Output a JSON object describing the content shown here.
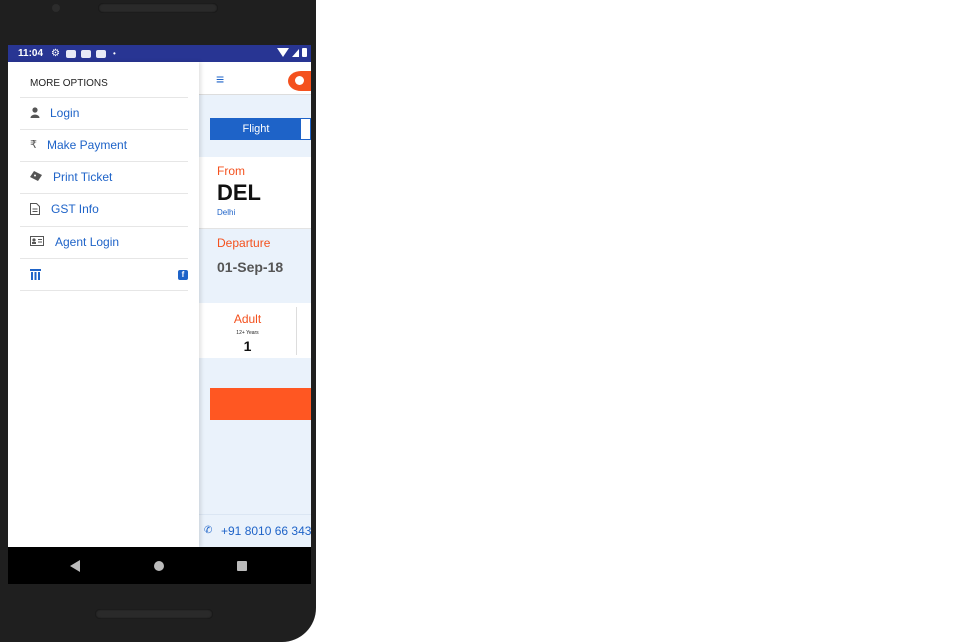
{
  "status_bar": {
    "time": "11:04"
  },
  "app": {
    "tab_flight": "Flight",
    "from_label": "From",
    "from_code": "DEL",
    "from_city": "Delhi",
    "departure_label": "Departure",
    "departure_date": "01-Sep-18",
    "adult_label": "Adult",
    "adult_sub": "12+ Years",
    "adult_count": "1",
    "phone": "+91 8010 66 343"
  },
  "drawer": {
    "title": "MORE OPTIONS",
    "items": [
      {
        "label": "Login",
        "icon": "user-icon"
      },
      {
        "label": "Make Payment",
        "icon": "rupee-icon"
      },
      {
        "label": "Print Ticket",
        "icon": "ticket-icon"
      },
      {
        "label": "GST Info",
        "icon": "document-icon"
      },
      {
        "label": "Agent Login",
        "icon": "id-card-icon"
      }
    ]
  },
  "colors": {
    "accent": "#1e63c8",
    "orange": "#f4511e",
    "statusbar": "#283593"
  }
}
